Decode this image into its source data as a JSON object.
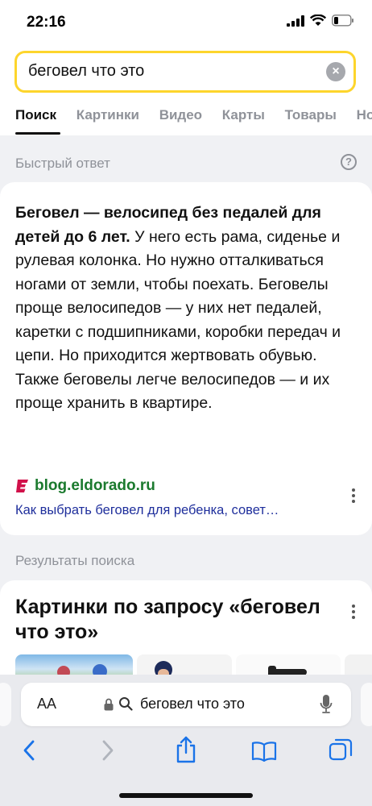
{
  "status": {
    "time": "22:16"
  },
  "search": {
    "query": "беговел что это"
  },
  "tabs": [
    "Поиск",
    "Картинки",
    "Видео",
    "Карты",
    "Товары",
    "Но"
  ],
  "quick_answer": {
    "label": "Быстрый ответ",
    "bold": "Беговел — велосипед без педалей для детей до 6 лет.",
    "text": " У него есть рама, сиденье и рулевая колонка. Но нужно отталкиваться ногами от земли, чтобы поехать. Беговелы проще велосипедов — у них нет педалей, каретки с подшипниками, коробки передач и цепи. Но приходится жертвовать обувью. Также беговелы легче велосипедов — и их проще хранить в квартире.",
    "source_domain": "blog.eldorado.ru",
    "source_title": "Как выбрать беговел для ребенка, совет…"
  },
  "results": {
    "label": "Результаты поиска",
    "images_title": "Картинки по запросу «беговел что это»"
  },
  "browser": {
    "aa": "AA",
    "address": "беговел что это"
  },
  "colors": {
    "search_border": "#fdd52c",
    "source_green": "#1b7a2e",
    "link_blue": "#1f2f9c",
    "toolbar_blue": "#1a73e8"
  }
}
